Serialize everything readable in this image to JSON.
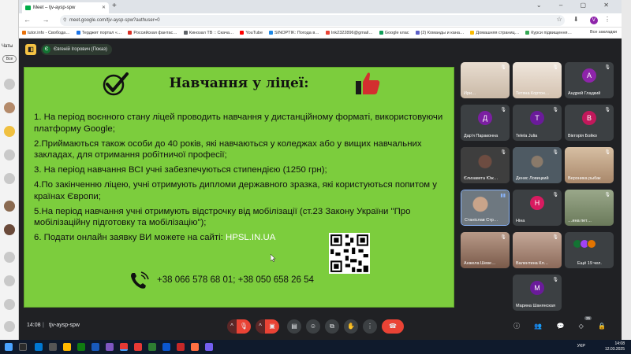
{
  "background_app": {
    "chats_label": "Чаты",
    "chip_label": "Все"
  },
  "browser": {
    "tab_title": "Meet – tjv-aysp-spw",
    "url": "meet.google.com/tjv-aysp-spw?authuser=0",
    "profile_initial": "V",
    "bookmarks": [
      "tutor.info - Свобода…",
      "Терджет портал «…",
      "Российская фантас…",
      "Кинозал ТВ :: Скача…",
      "YouTube",
      "SINOPTIK: Погода в…",
      "Ink2322896@gmail…",
      "Google клас",
      "(2) Команды и кана…",
      "Домашняя страниц…",
      "Курси підвищення…"
    ],
    "all_bookmarks": "Все закладки"
  },
  "meet": {
    "presenter": "Євгеній Ігорович (Показ)",
    "presenter_initial": "Є",
    "slide": {
      "title": "Навчання у ліцеї:",
      "items": [
        "1. На період воєнного стану ліцей проводить навчання у дистанційному форматі, використовуючи платформу Google;",
        "2.Приймаються також особи до 40 років, які навчаються у коледжах або у вищих навчальних закладах, для отримання робітничої професії;",
        "3. На період навчання ВСІ учні забезпечуються стипендією (1250 грн);",
        "4.По закінченню ліцею, учні отримують дипломи державного зразка, які користуються попитом у країнах Європи;",
        "5.На період навчання учні отримують відстрочку від мобілізації (ст.23 Закону України \"Про мобілізаційну підготовку та мобілізацію\");",
        "6. Подати онлайн заявку ВИ можете на сайті:"
      ],
      "site": "HPSL.IN.UA",
      "phones": "+38 066 578 68 01; +38 050 658 26 54"
    },
    "participants": [
      {
        "name": "Ири…",
        "type": "photo",
        "color": "#d7c9b8"
      },
      {
        "name": "Тетяна Кортон…",
        "type": "photo",
        "color": "#e2d6c8"
      },
      {
        "name": "Андрей Гладкий",
        "type": "letter",
        "letter": "А",
        "color": "#8e24aa"
      },
      {
        "name": "Дар'я Параконна",
        "type": "letter",
        "letter": "Д",
        "color": "#7b1fa2"
      },
      {
        "name": "Telela Julia",
        "type": "letter",
        "letter": "T",
        "color": "#6a1b9a"
      },
      {
        "name": "Вікторія Бойко",
        "type": "letter",
        "letter": "В",
        "color": "#c2185b"
      },
      {
        "name": "Єлизавета Юж…",
        "type": "photo",
        "color": "#5d4037"
      },
      {
        "name": "Денис Ловицкий",
        "type": "photo",
        "color": "#4e5a63"
      },
      {
        "name": "Вероника рыбак",
        "type": "photo",
        "color": "#c8a98b"
      },
      {
        "name": "Станіслав Стр…",
        "type": "photo",
        "color": "#707a82"
      },
      {
        "name": "Ніна",
        "type": "letter",
        "letter": "Н",
        "color": "#d81b60"
      },
      {
        "name": "…ина пет…",
        "type": "photo",
        "color": "#7a8a6a"
      },
      {
        "name": "Анжела Шеве…",
        "type": "photo",
        "color": "#a08070"
      },
      {
        "name": "Валентина Кл…",
        "type": "photo",
        "color": "#9c7a6a"
      },
      {
        "name": "Ещё 19 чел.",
        "type": "more",
        "color": "#3c4043"
      },
      {
        "name": "Марина Шанянская",
        "type": "letter",
        "letter": "М",
        "color": "#6a1b9a"
      }
    ],
    "bottom": {
      "time": "14:08",
      "code": "tjv-aysp-spw",
      "people_count": "35"
    }
  },
  "taskbar": {
    "lang": "УКР",
    "time": "14:08",
    "date": "12.03.2025"
  }
}
